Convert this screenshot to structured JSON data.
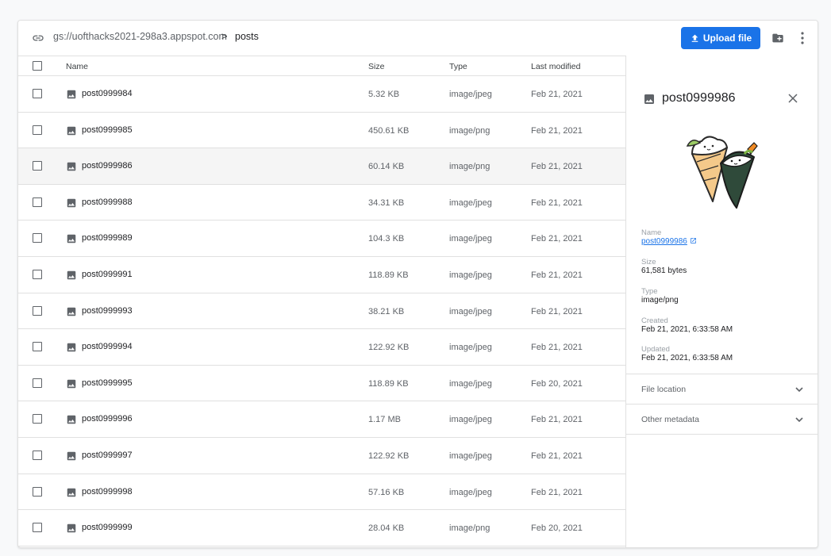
{
  "breadcrumb": {
    "bucket": "gs://uofthacks2021-298a3.appspot.com",
    "separator": ">",
    "folder": "posts"
  },
  "toolbar": {
    "upload_label": "Upload file"
  },
  "table": {
    "headers": {
      "name": "Name",
      "size": "Size",
      "type": "Type",
      "modified": "Last modified"
    },
    "rows": [
      {
        "name": "post0999984",
        "size": "5.32 KB",
        "type": "image/jpeg",
        "modified": "Feb 21, 2021"
      },
      {
        "name": "post0999985",
        "size": "450.61 KB",
        "type": "image/png",
        "modified": "Feb 21, 2021"
      },
      {
        "name": "post0999986",
        "size": "60.14 KB",
        "type": "image/png",
        "modified": "Feb 21, 2021"
      },
      {
        "name": "post0999988",
        "size": "34.31 KB",
        "type": "image/jpeg",
        "modified": "Feb 21, 2021"
      },
      {
        "name": "post0999989",
        "size": "104.3 KB",
        "type": "image/jpeg",
        "modified": "Feb 21, 2021"
      },
      {
        "name": "post0999991",
        "size": "118.89 KB",
        "type": "image/jpeg",
        "modified": "Feb 21, 2021"
      },
      {
        "name": "post0999993",
        "size": "38.21 KB",
        "type": "image/jpeg",
        "modified": "Feb 21, 2021"
      },
      {
        "name": "post0999994",
        "size": "122.92 KB",
        "type": "image/jpeg",
        "modified": "Feb 21, 2021"
      },
      {
        "name": "post0999995",
        "size": "118.89 KB",
        "type": "image/jpeg",
        "modified": "Feb 20, 2021"
      },
      {
        "name": "post0999996",
        "size": "1.17 MB",
        "type": "image/jpeg",
        "modified": "Feb 21, 2021"
      },
      {
        "name": "post0999997",
        "size": "122.92 KB",
        "type": "image/jpeg",
        "modified": "Feb 21, 2021"
      },
      {
        "name": "post0999998",
        "size": "57.16 KB",
        "type": "image/jpeg",
        "modified": "Feb 21, 2021"
      },
      {
        "name": "post0999999",
        "size": "28.04 KB",
        "type": "image/png",
        "modified": "Feb 20, 2021"
      }
    ]
  },
  "details": {
    "title": "post0999986",
    "name_label": "Name",
    "name_value": "post0999986",
    "size_label": "Size",
    "size_value": "61,581 bytes",
    "type_label": "Type",
    "type_value": "image/png",
    "created_label": "Created",
    "created_value": "Feb 21, 2021, 6:33:58 AM",
    "updated_label": "Updated",
    "updated_value": "Feb 21, 2021, 6:33:58 AM",
    "sections": [
      {
        "label": "File location"
      },
      {
        "label": "Other metadata"
      }
    ]
  },
  "colors": {
    "accent": "#1a73e8",
    "selected_row": "#f5f5f5"
  },
  "icons": {
    "breadcrumb": "link-icon",
    "upload": "upload-icon",
    "new_folder": "new-folder-icon",
    "more": "more-vert-icon",
    "file": "image-file-icon",
    "close": "close-icon",
    "open_external": "open-in-new-icon",
    "expand": "chevron-down-icon"
  }
}
